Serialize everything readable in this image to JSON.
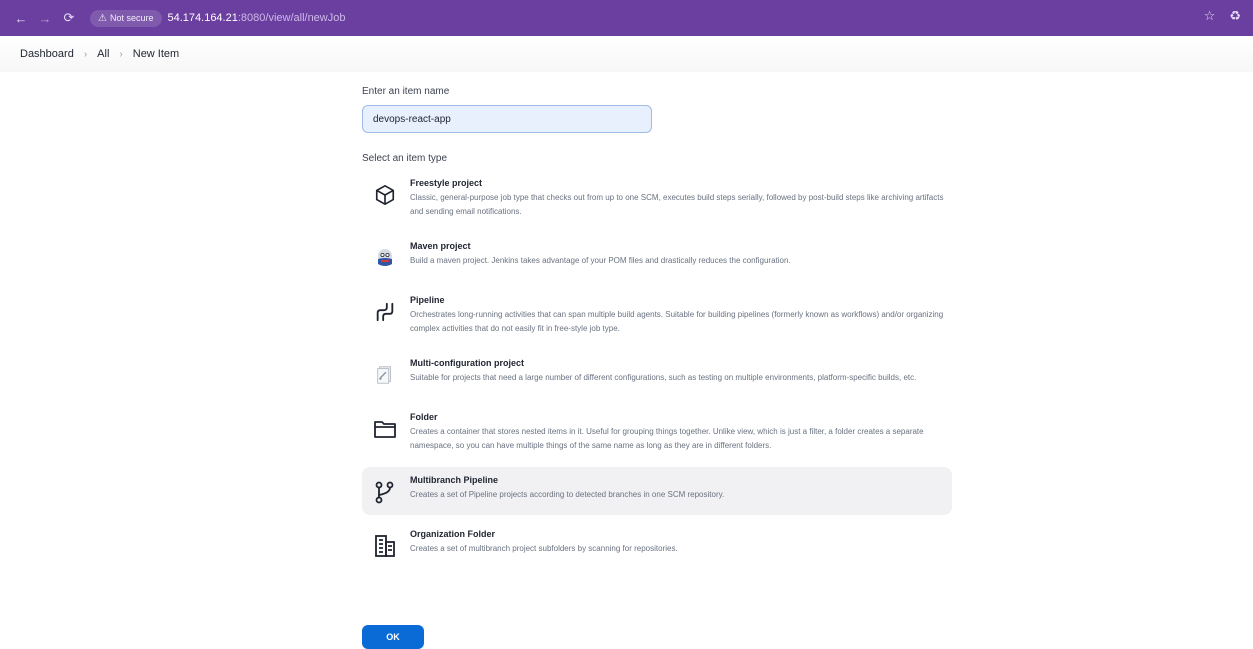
{
  "browser": {
    "security_label": "Not secure",
    "url_host": "54.174.164.21",
    "url_path": ":8080/view/all/newJob"
  },
  "breadcrumb": {
    "items": [
      "Dashboard",
      "All",
      "New Item"
    ]
  },
  "form": {
    "name_label": "Enter an item name",
    "name_value": "devops-react-app",
    "type_label": "Select an item type",
    "ok_label": "OK"
  },
  "item_types": [
    {
      "title": "Freestyle project",
      "description": "Classic, general-purpose job type that checks out from up to one SCM, executes build steps serially, followed by post-build steps like archiving artifacts and sending email notifications.",
      "icon": "freestyle-cube-icon"
    },
    {
      "title": "Maven project",
      "description": "Build a maven project. Jenkins takes advantage of your POM files and drastically reduces the configuration.",
      "icon": "maven-jenkins-icon"
    },
    {
      "title": "Pipeline",
      "description": "Orchestrates long-running activities that can span multiple build agents. Suitable for building pipelines (formerly known as workflows) and/or organizing complex activities that do not easily fit in free-style job type.",
      "icon": "pipeline-icon"
    },
    {
      "title": "Multi-configuration project",
      "description": "Suitable for projects that need a large number of different configurations, such as testing on multiple environments, platform-specific builds, etc.",
      "icon": "multi-config-icon"
    },
    {
      "title": "Folder",
      "description": "Creates a container that stores nested items in it. Useful for grouping things together. Unlike view, which is just a filter, a folder creates a separate namespace, so you can have multiple things of the same name as long as they are in different folders.",
      "icon": "folder-icon"
    },
    {
      "title": "Multibranch Pipeline",
      "description": "Creates a set of Pipeline projects according to detected branches in one SCM repository.",
      "icon": "branch-icon"
    },
    {
      "title": "Organization Folder",
      "description": "Creates a set of multibranch project subfolders by scanning for repositories.",
      "icon": "organization-building-icon"
    }
  ]
}
